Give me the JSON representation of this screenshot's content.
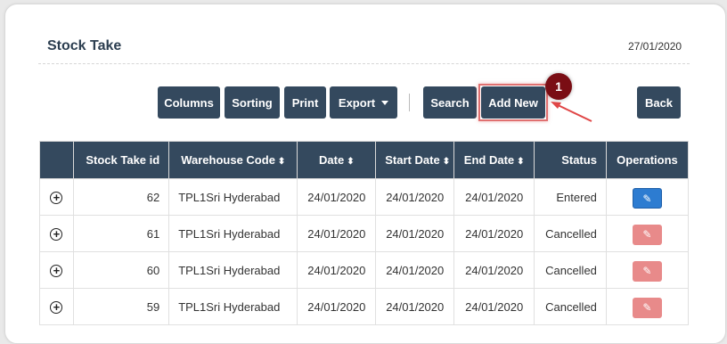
{
  "page": {
    "title": "Stock Take",
    "date": "27/01/2020"
  },
  "toolbar": {
    "columns_label": "Columns",
    "sorting_label": "Sorting",
    "print_label": "Print",
    "export_label": "Export",
    "search_label": "Search",
    "add_new_label": "Add New",
    "back_label": "Back"
  },
  "callout": {
    "number": "1"
  },
  "table": {
    "headers": {
      "stock_take_id": "Stock Take id",
      "warehouse_code": "Warehouse Code",
      "date": "Date",
      "start_date": "Start Date",
      "end_date": "End Date",
      "status": "Status",
      "operations": "Operations"
    },
    "rows": [
      {
        "id": "62",
        "warehouse": "TPL1Sri Hyderabad",
        "date": "24/01/2020",
        "start": "24/01/2020",
        "end": "24/01/2020",
        "status": "Entered",
        "edit_enabled": true
      },
      {
        "id": "61",
        "warehouse": "TPL1Sri Hyderabad",
        "date": "24/01/2020",
        "start": "24/01/2020",
        "end": "24/01/2020",
        "status": "Cancelled",
        "edit_enabled": false
      },
      {
        "id": "60",
        "warehouse": "TPL1Sri Hyderabad",
        "date": "24/01/2020",
        "start": "24/01/2020",
        "end": "24/01/2020",
        "status": "Cancelled",
        "edit_enabled": false
      },
      {
        "id": "59",
        "warehouse": "TPL1Sri Hyderabad",
        "date": "24/01/2020",
        "start": "24/01/2020",
        "end": "24/01/2020",
        "status": "Cancelled",
        "edit_enabled": false
      }
    ]
  },
  "icons": {
    "expand": "plus-circle-icon",
    "edit": "pencil-icon",
    "sort": "sort-arrows-icon",
    "dropdown": "caret-down-icon"
  },
  "colors": {
    "primary": "#34495e",
    "edit_active": "#2d7cd1",
    "edit_disabled": "#e88a8a",
    "callout": "#7a0d14",
    "highlight": "#e07070"
  }
}
